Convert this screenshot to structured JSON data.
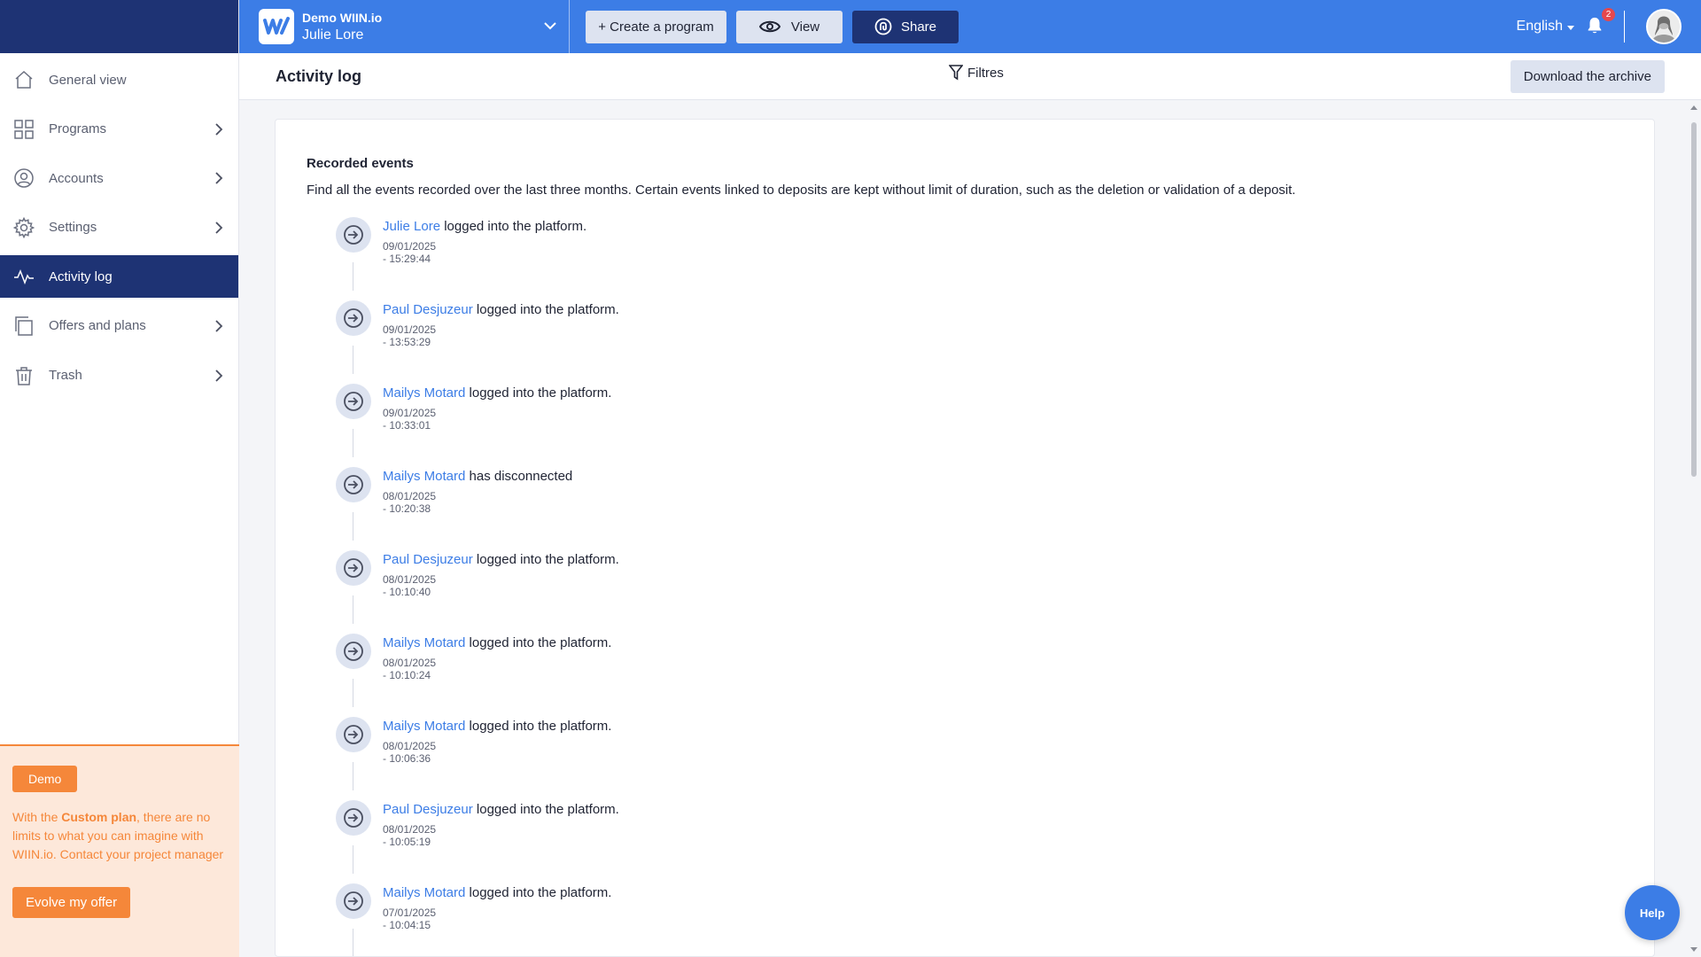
{
  "brand": {
    "org": "Demo WIIN.io",
    "user": "Julie Lore"
  },
  "toolbar": {
    "create_label": "+ Create a program",
    "view_label": "View",
    "share_label": "Share"
  },
  "header": {
    "language": "English",
    "notifications_count": "2"
  },
  "sidebar": {
    "items": [
      {
        "label": "General view",
        "icon": "home-icon"
      },
      {
        "label": "Programs",
        "icon": "grid-icon"
      },
      {
        "label": "Accounts",
        "icon": "user-circle-icon"
      },
      {
        "label": "Settings",
        "icon": "gear-icon"
      },
      {
        "label": "Activity log",
        "icon": "activity-icon",
        "active": true
      },
      {
        "label": "Offers and plans",
        "icon": "copy-icon"
      },
      {
        "label": "Trash",
        "icon": "trash-icon"
      }
    ],
    "promo": {
      "badge": "Demo",
      "text_before": "With the ",
      "text_bold": "Custom plan",
      "text_after": ", there are no limits to what you can imagine with WIIN.io. Contact your project manager",
      "button": "Evolve my offer"
    }
  },
  "page": {
    "title": "Activity log",
    "filters_label": "Filtres",
    "download_label": "Download the archive",
    "heading": "Recorded events",
    "description": "Find all the events recorded over the last three months. Certain events linked to deposits are kept without limit of duration, such as the deletion or validation of a deposit."
  },
  "events": [
    {
      "who": "Julie Lore",
      "action": "logged into the platform.",
      "timestamp": "09/01/2025 - 15:29:44"
    },
    {
      "who": "Paul Desjuzeur",
      "action": "logged into the platform.",
      "timestamp": "09/01/2025 - 13:53:29"
    },
    {
      "who": "Mailys Motard",
      "action": "logged into the platform.",
      "timestamp": "09/01/2025 - 10:33:01"
    },
    {
      "who": "Mailys Motard",
      "action": "has disconnected",
      "timestamp": "08/01/2025 - 10:20:38"
    },
    {
      "who": "Paul Desjuzeur",
      "action": "logged into the platform.",
      "timestamp": "08/01/2025 - 10:10:40"
    },
    {
      "who": "Mailys Motard",
      "action": "logged into the platform.",
      "timestamp": "08/01/2025 - 10:10:24"
    },
    {
      "who": "Mailys Motard",
      "action": "logged into the platform.",
      "timestamp": "08/01/2025 - 10:06:36"
    },
    {
      "who": "Paul Desjuzeur",
      "action": "logged into the platform.",
      "timestamp": "08/01/2025 - 10:05:19"
    },
    {
      "who": "Mailys Motard",
      "action": "logged into the platform.",
      "timestamp": "07/01/2025 - 10:04:15"
    }
  ],
  "help_label": "Help",
  "colors": {
    "primary": "#3c7de6",
    "navy": "#1e3374",
    "accent": "#f5873a",
    "promo_bg": "#fde8da",
    "alert": "#e5484d"
  }
}
